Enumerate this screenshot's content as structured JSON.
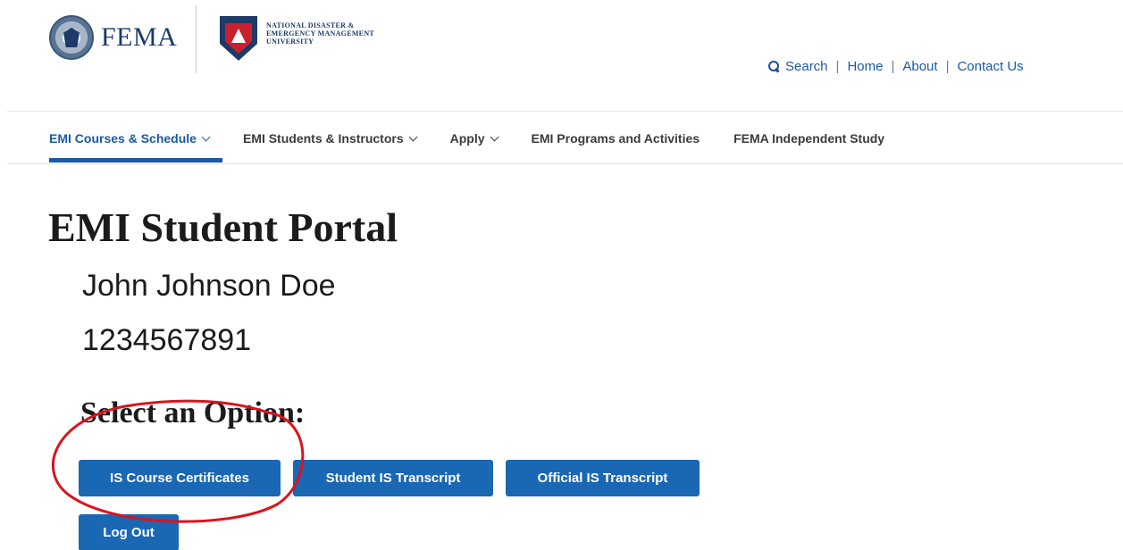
{
  "header": {
    "fema_text": "FEMA",
    "nde_line1": "NATIONAL DISASTER &",
    "nde_line2": "EMERGENCY MANAGEMENT",
    "nde_line3": "UNIVERSITY",
    "util_nav": {
      "search": "Search",
      "home": "Home",
      "about": "About",
      "contact": "Contact Us",
      "separator": "|"
    }
  },
  "main_nav": {
    "items": [
      {
        "label": "EMI Courses & Schedule",
        "active": true
      },
      {
        "label": "EMI Students & Instructors"
      },
      {
        "label": "Apply"
      },
      {
        "label": "EMI Programs and Activities"
      },
      {
        "label": "FEMA Independent Study"
      }
    ]
  },
  "content": {
    "title": "EMI Student Portal",
    "student_name": "John Johnson Doe",
    "student_id": "1234567891",
    "option_heading": "Select an Option:",
    "buttons": {
      "certificates": "IS Course Certificates",
      "student_transcript": "Student IS Transcript",
      "official_transcript": "Official IS Transcript",
      "logout": "Log Out"
    }
  },
  "colors": {
    "brand_blue": "#1a67b4",
    "nav_active": "#1a5aa6",
    "annotation_red": "#d9141f"
  },
  "icons": [
    "dhs-seal-icon",
    "nde-shield-icon",
    "search-icon",
    "chevron-down-icon"
  ]
}
